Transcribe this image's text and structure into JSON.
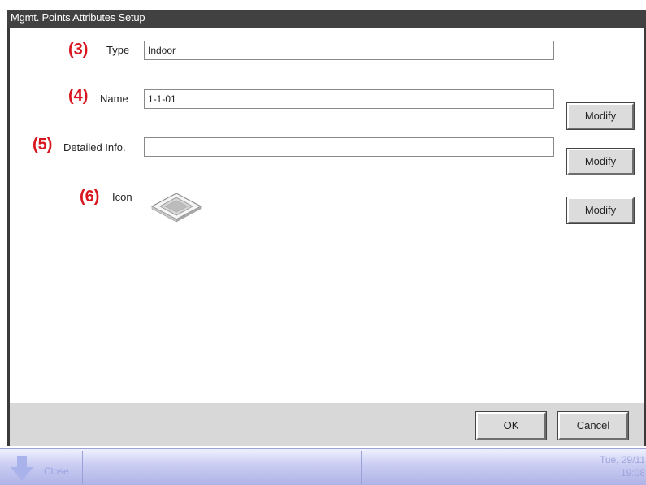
{
  "window": {
    "title": "Mgmt. Points Attributes Setup"
  },
  "fields": [
    {
      "num": "(3)",
      "label": "Type",
      "value": "Indoor"
    },
    {
      "num": "(4)",
      "label": "Name",
      "value": "1-1-01",
      "button": "Modify"
    },
    {
      "num": "(5)",
      "label": "Detailed Info.",
      "value": "",
      "button": "Modify"
    },
    {
      "num": "(6)",
      "label": "Icon",
      "icon": "ceiling-cassette-icon",
      "button": "Modify"
    }
  ],
  "footer": {
    "ok_label": "OK",
    "cancel_label": "Cancel"
  },
  "taskbar": {
    "close_label": "Close",
    "date": "Tue, 29/11",
    "time": "19:08"
  },
  "colors": {
    "accent_number": "#d9151d",
    "titlebar": "#414141",
    "taskbar": "#c9ccf2"
  }
}
